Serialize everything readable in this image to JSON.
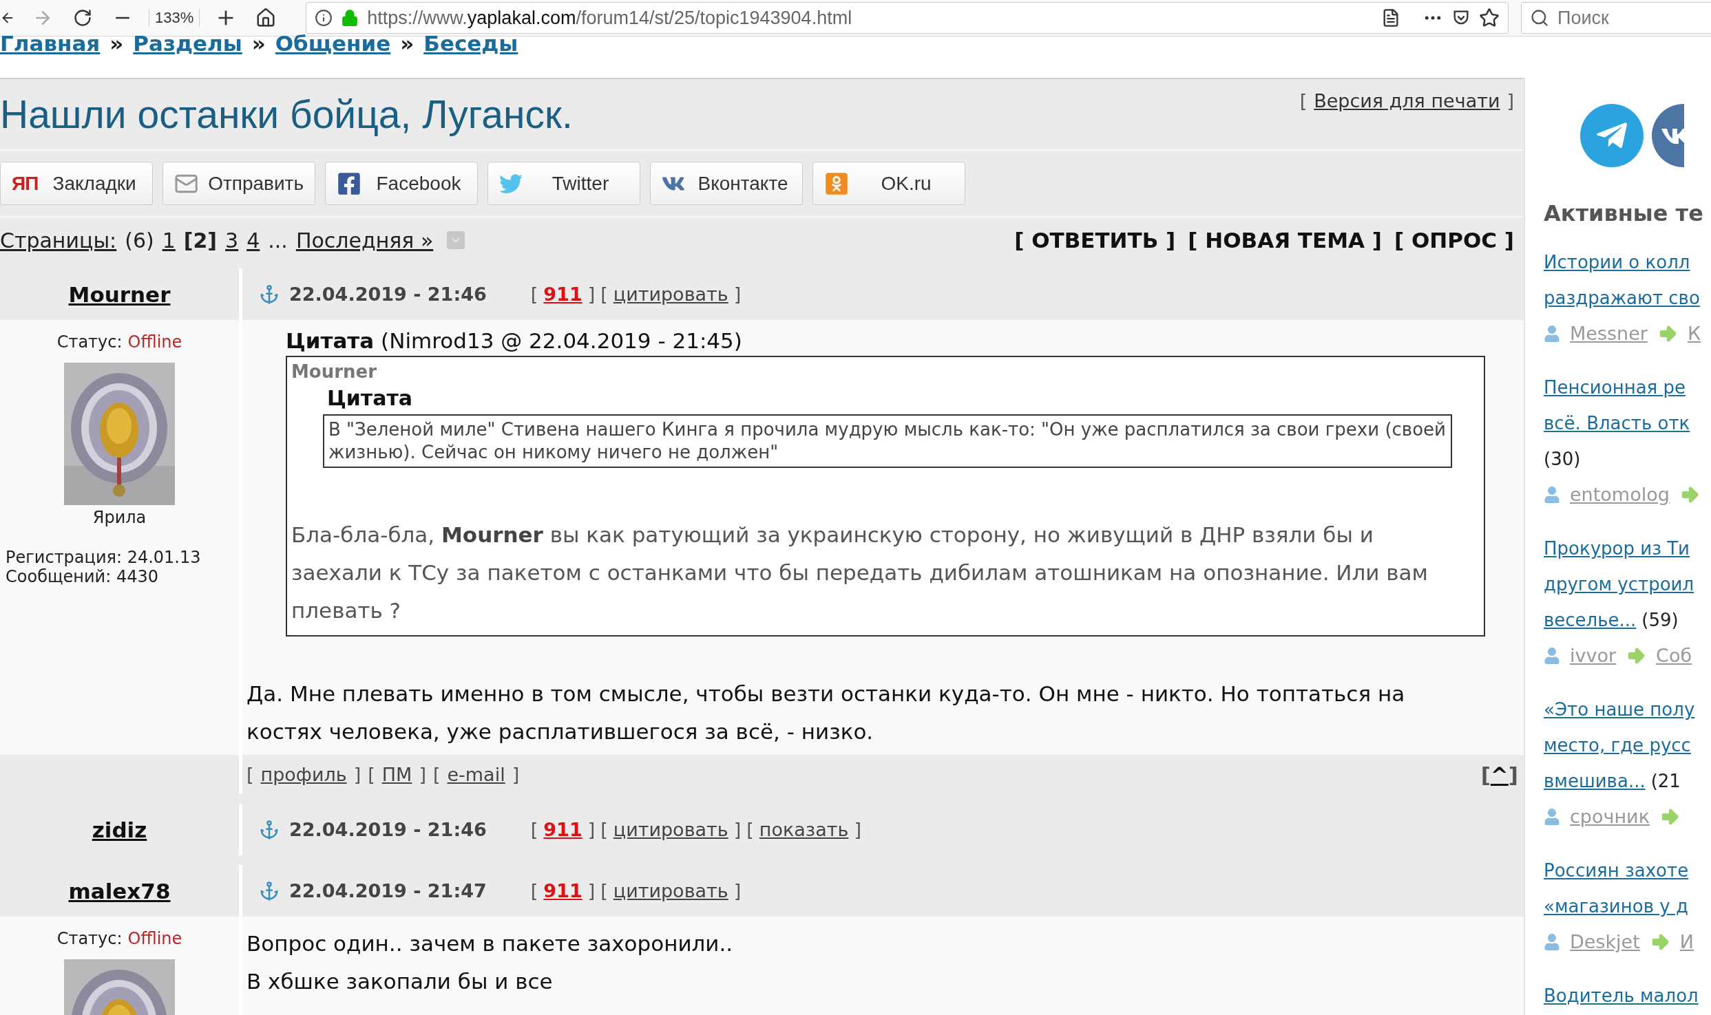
{
  "browser": {
    "zoom": "133%",
    "url": "https://www.**yaplakal.com**/forum14/st/25/topic1943904.html",
    "search_placeholder": "Поиск"
  },
  "breadcrumb": [
    {
      "label": "Главная"
    },
    {
      "separator": "»",
      "label": "Разделы"
    },
    {
      "separator": "»",
      "label": "Общение"
    },
    {
      "separator": "»",
      "label": "Беседы"
    }
  ],
  "topic": {
    "title": "Нашли останки бойца, Луганск.",
    "print": {
      "open": "[",
      "label": "Версия для печати",
      "close": "]"
    }
  },
  "share_buttons": [
    {
      "kind": "yap",
      "logo": "ЯП",
      "label": "Закладки"
    },
    {
      "kind": "mail",
      "label": "Отправить"
    },
    {
      "kind": "facebook",
      "label": "Facebook"
    },
    {
      "kind": "twitter",
      "label": "Twitter"
    },
    {
      "kind": "vk",
      "label": "Вконтакте"
    },
    {
      "kind": "ok",
      "label": "OK.ru"
    }
  ],
  "pager": {
    "label": "Страницы:",
    "total": "(6)",
    "pages": [
      {
        "label": "1",
        "selected": false
      },
      {
        "label": "[2]",
        "selected": true
      },
      {
        "label": "3",
        "selected": false
      },
      {
        "label": "4",
        "selected": false
      }
    ],
    "ellipsis": "...",
    "last": "Последняя »"
  },
  "topic_actions": [
    "[ ОТВЕТИТЬ ]",
    "[ НОВАЯ ТЕМА ]",
    "[ ОПРОС ]"
  ],
  "posts": [
    {
      "author": "Mourner",
      "date": "22.04.2019 - 21:46",
      "actions": [
        {
          "open": "[",
          "label": "911",
          "close": "]",
          "kind": "alert"
        },
        {
          "open": "[",
          "label": "цитировать",
          "close": "]",
          "kind": "link"
        }
      ],
      "profile": {
        "status_label": "Статус:",
        "status": "Offline",
        "rank": "Ярила",
        "registration": "Регистрация: 24.01.13",
        "messages": "Сообщений: 4430"
      },
      "quote": {
        "header": "**Цитата** (Nimrod13 @ 22.04.2019 - 21:45)",
        "author": "Mourner",
        "inner_title": "Цитата",
        "inner_text": "В \"Зеленой миле\" Стивена нашего Кинга я прочила мудрую мысль как-то: \"Он уже расплатился за свои грехи (своей жизнью). Сейчас он никому ничего не должен\"",
        "text": "Бла-бла-бла, **Mourner** вы как ратующий за украинскую сторону, но живущий в ДНР взяли бы и заехали к ТСу за пакетом с останками что бы передать дибилам атошникам на опознание. Или вам плевать ?"
      },
      "body": [
        "Да. Мне плевать именно в том смысле, чтобы везти останки куда-то. Он мне - никто. Но топтаться на костях человека, уже расплатившегося за всё, - низко."
      ],
      "footer": {
        "links": [
          {
            "open": "[",
            "label": "профиль",
            "close": "]"
          },
          {
            "open": "[",
            "label": "ПМ",
            "close": "]"
          },
          {
            "open": "[",
            "label": "e-mail",
            "close": "]"
          }
        ],
        "top": {
          "open": "[",
          "label": "^",
          "close": "]"
        }
      }
    },
    {
      "author": "zidiz",
      "date": "22.04.2019 - 21:46",
      "actions": [
        {
          "open": "[",
          "label": "911",
          "close": "]",
          "kind": "alert"
        },
        {
          "open": "[",
          "label": "цитировать",
          "close": "]",
          "kind": "link"
        },
        {
          "open": "[",
          "label": "показать",
          "close": "]",
          "kind": "link"
        }
      ]
    },
    {
      "author": "malex78",
      "date": "22.04.2019 - 21:47",
      "actions": [
        {
          "open": "[",
          "label": "911",
          "close": "]",
          "kind": "alert"
        },
        {
          "open": "[",
          "label": "цитировать",
          "close": "]",
          "kind": "link"
        }
      ],
      "profile": {
        "status_label": "Статус:",
        "status": "Offline"
      },
      "body": [
        "Вопрос один.. зачем в пакете захоронили..",
        "В хбшке закопали бы и все"
      ]
    }
  ],
  "sidebar": {
    "heading": "Активные те",
    "topics": [
      {
        "lines": [
          "Истории о колл",
          "раздражают сво"
        ],
        "user": "Messner",
        "target": "К"
      },
      {
        "lines": [
          "Пенсионная ре",
          "всё. Власть отк"
        ],
        "count": "(30)",
        "count_wraps": true,
        "user": "entomolog"
      },
      {
        "lines": [
          "Прокурор из Ти",
          "другом устроил",
          "веселье..."
        ],
        "count": "(59)",
        "count_wraps": false,
        "user": "ivvor",
        "target": "Соб"
      },
      {
        "lines": [
          "«Это наше полу",
          "место, где русс",
          "вмешива..."
        ],
        "count": "(21",
        "count_wraps": false,
        "user": "срочник"
      },
      {
        "lines": [
          "Россиян захоте",
          "«магазинов у д"
        ],
        "user": "Deskjet",
        "target": "И"
      },
      {
        "lines": [
          "Водитель малол"
        ]
      }
    ]
  }
}
